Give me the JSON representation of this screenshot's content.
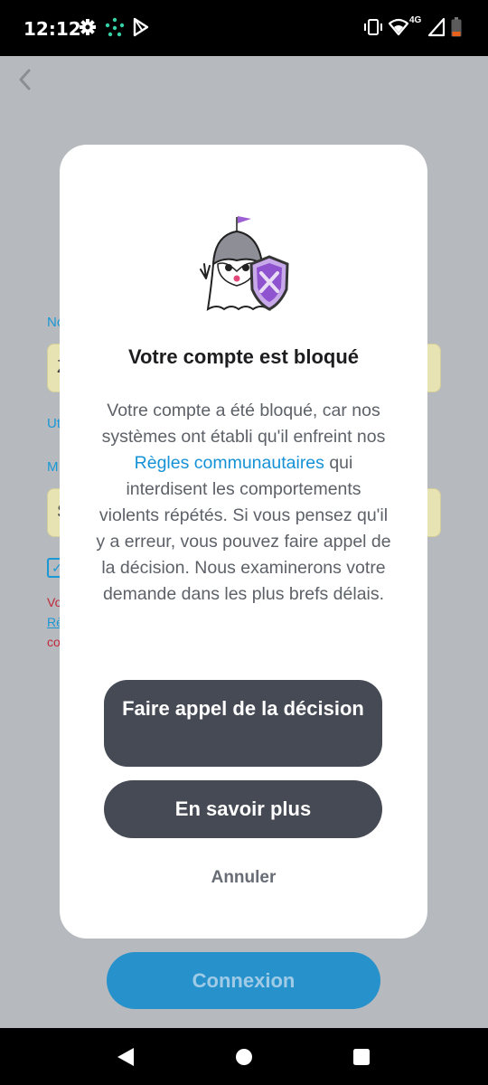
{
  "status_bar": {
    "time": "12:12",
    "network": "4G"
  },
  "background": {
    "label_1": "No",
    "field_1_value": "Z",
    "label_2": "Ut",
    "label_3": "M",
    "field_2_value": "S",
    "error_line_1": "Vo",
    "error_line_2": "Rè",
    "error_line_3": "co",
    "login_button": "Connexion"
  },
  "modal": {
    "title": "Votre compte est bloqué",
    "body_part1": "Votre compte a été bloqué, car nos systèmes ont établi qu'il enfreint nos ",
    "body_link": "Règles communautaires",
    "body_part2": " qui interdisent les comportements violents répétés. Si vous pensez qu'il y a erreur, vous pouvez faire appel de la décision. Nous examinerons votre demande dans les plus brefs délais.",
    "appeal_button": "Faire appel de la décision",
    "learn_more_button": "En savoir plus",
    "cancel_button": "Annuler"
  },
  "colors": {
    "accent": "#1592d6",
    "button_dark": "#454a54",
    "login_blue": "#2791cc"
  },
  "icons": [
    "settings-icon",
    "dots-icon",
    "play-store-icon",
    "vibrate-icon",
    "wifi-icon",
    "signal-icon",
    "battery-icon",
    "back-icon",
    "ghost-knight-icon",
    "nav-back-icon",
    "nav-home-icon",
    "nav-recents-icon"
  ]
}
